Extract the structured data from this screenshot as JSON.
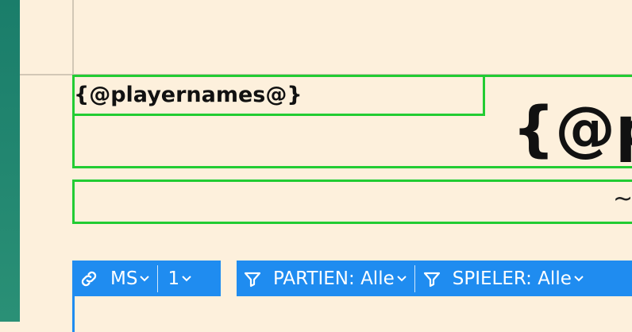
{
  "template": {
    "player_names": "{@playernames@}",
    "main_title": "{@p",
    "subtitle": "~"
  },
  "toolbar": {
    "link_label": "MS",
    "link_icon": "link-icon",
    "number_label": "1",
    "filter_icon": "filter-icon",
    "partien_label": "PARTIEN: Alle",
    "spieler_label": "SPIELER: Alle"
  },
  "colors": {
    "background": "#fdf0dc",
    "side_strip": "#1a7d6a",
    "frame_green": "#22cc33",
    "toolbar_blue": "#1f8cf0"
  }
}
